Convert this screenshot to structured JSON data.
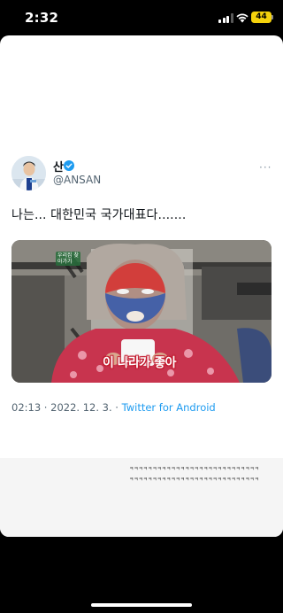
{
  "status_bar": {
    "time": "2:32",
    "battery_level": "44",
    "battery_color": "#f5d20c",
    "icons": [
      "signal-icon",
      "wifi-icon",
      "battery-icon"
    ]
  },
  "tweet": {
    "display_name": "산",
    "handle": "@ANSAN",
    "more_label": "···",
    "text": "나는... 대한민국 국가대표다.......",
    "media": {
      "caption": "이 나라가 좋아",
      "tv_logo": "우리집 찾아가기"
    },
    "meta": {
      "time": "02:13",
      "separator": " · ",
      "date": "2022. 12. 3.",
      "client": "Twitter for Android"
    },
    "verified_color": "#1d9bf0"
  },
  "reply": {
    "lines": [
      "ㅋㅋㅋㅋㅋㅋㅋㅋㅋㅋㅋㅋㅋㅋㅋㅋㅋㅋㅋㅋㅋㅋㅋㅋㅋㅋㅋㅋ",
      "ㅋㅋㅋㅋㅋㅋㅋㅋㅋㅋㅋㅋㅋㅋㅋㅋㅋㅋㅋㅋㅋㅋㅋㅋㅋㅋㅋㅋ"
    ]
  }
}
